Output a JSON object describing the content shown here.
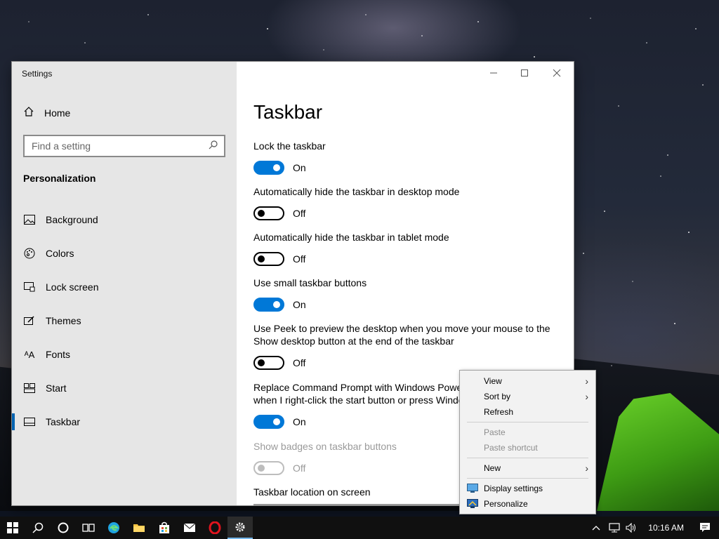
{
  "window": {
    "title": "Settings",
    "controls": {
      "minimize": "—",
      "maximize": "☐",
      "close": "✕"
    }
  },
  "sidebar": {
    "home_label": "Home",
    "search_placeholder": "Find a setting",
    "section_title": "Personalization",
    "items": [
      {
        "label": "Background",
        "icon": "picture-icon"
      },
      {
        "label": "Colors",
        "icon": "palette-icon"
      },
      {
        "label": "Lock screen",
        "icon": "lock-screen-icon"
      },
      {
        "label": "Themes",
        "icon": "brush-icon"
      },
      {
        "label": "Fonts",
        "icon": "font-icon"
      },
      {
        "label": "Start",
        "icon": "start-tiles-icon"
      },
      {
        "label": "Taskbar",
        "icon": "taskbar-icon",
        "active": true
      }
    ]
  },
  "main": {
    "page_title": "Taskbar",
    "settings": [
      {
        "label": "Lock the taskbar",
        "state": "On",
        "on": true
      },
      {
        "label": "Automatically hide the taskbar in desktop mode",
        "state": "Off",
        "on": false
      },
      {
        "label": "Automatically hide the taskbar in tablet mode",
        "state": "Off",
        "on": false
      },
      {
        "label": "Use small taskbar buttons",
        "state": "On",
        "on": true
      },
      {
        "label": "Use Peek to preview the desktop when you move your mouse to the Show desktop button at the end of the taskbar",
        "state": "Off",
        "on": false
      },
      {
        "label": "Replace Command Prompt with Windows PowerShell in the menu when I right-click the start button or press Windows key + X",
        "state": "On",
        "on": true
      },
      {
        "label": "Show badges on taskbar buttons",
        "state": "Off",
        "on": false,
        "disabled": true
      }
    ],
    "location_label": "Taskbar location on screen"
  },
  "context_menu": {
    "items": [
      {
        "label": "View",
        "submenu": true
      },
      {
        "label": "Sort by",
        "submenu": true
      },
      {
        "label": "Refresh"
      },
      {
        "label": "Paste",
        "disabled": true
      },
      {
        "label": "Paste shortcut",
        "disabled": true
      },
      {
        "label": "New",
        "submenu": true
      },
      {
        "label": "Display settings",
        "icon": "display-icon"
      },
      {
        "label": "Personalize",
        "icon": "personalize-icon"
      }
    ]
  },
  "taskbar": {
    "clock": "10:16 AM",
    "apps": [
      "start-icon",
      "search-icon",
      "cortana-icon",
      "task-view-icon",
      "edge-icon",
      "file-explorer-icon",
      "store-icon",
      "mail-icon",
      "opera-browser-icon",
      "settings-icon"
    ]
  },
  "colors": {
    "accent": "#0078d7",
    "sidebar_bg": "#e6e6e6"
  }
}
